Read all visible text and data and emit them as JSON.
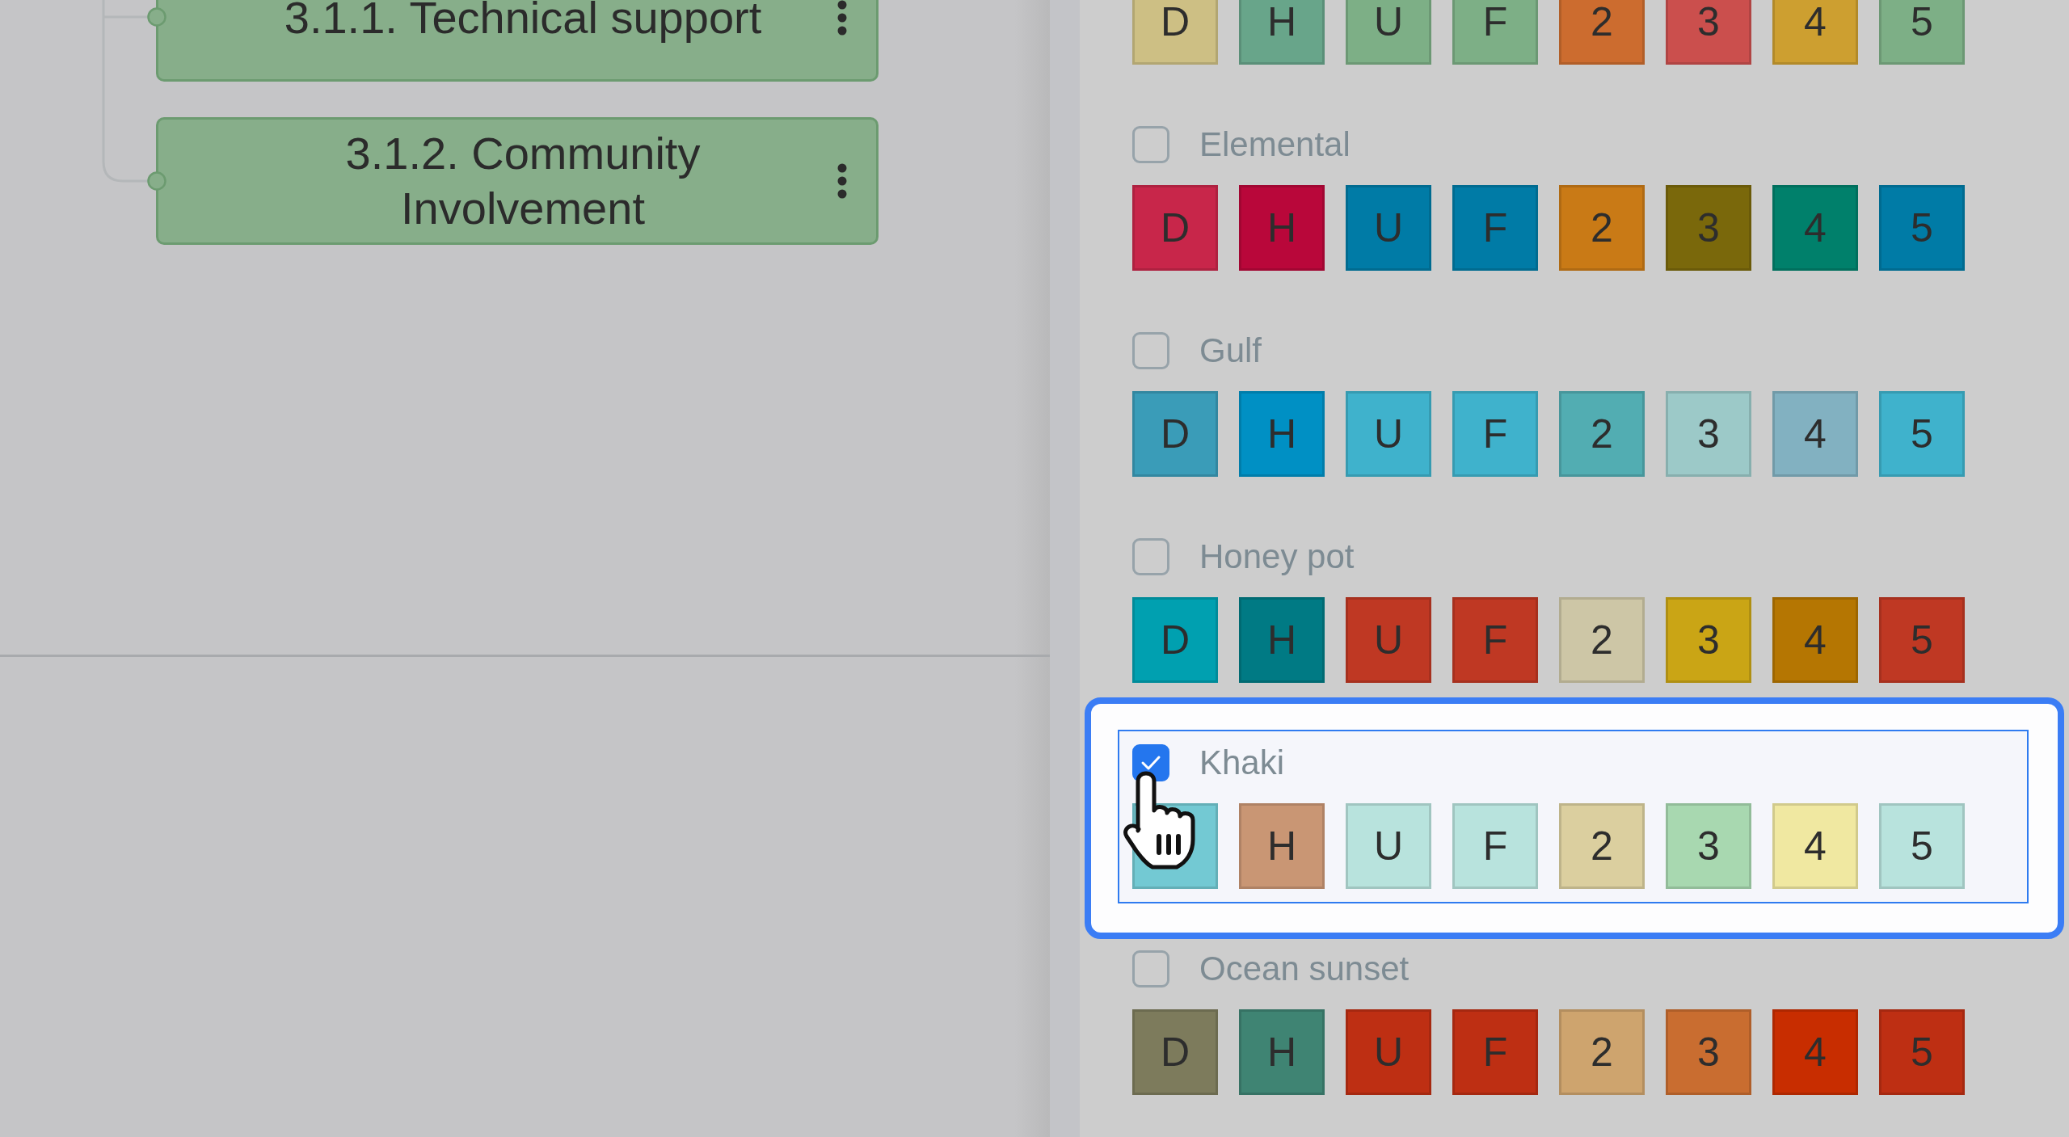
{
  "mind_map": {
    "nodes": [
      {
        "label": "3.1.1. Technical support"
      },
      {
        "label": "3.1.2. Community Involvement"
      }
    ]
  },
  "top_palette_swatches": [
    {
      "label": "D",
      "color": "#cdbf84"
    },
    {
      "label": "H",
      "color": "#68a58a"
    },
    {
      "label": "U",
      "color": "#7daf86"
    },
    {
      "label": "F",
      "color": "#7daf86"
    },
    {
      "label": "2",
      "color": "#cc6c2f"
    },
    {
      "label": "3",
      "color": "#cb4f4d"
    },
    {
      "label": "4",
      "color": "#cd9f30"
    },
    {
      "label": "5",
      "color": "#7daf86"
    }
  ],
  "palettes": [
    {
      "name": "Elemental",
      "checked": false,
      "selected": false,
      "swatches": [
        {
          "label": "D",
          "color": "#c8264a"
        },
        {
          "label": "H",
          "color": "#b9073a"
        },
        {
          "label": "U",
          "color": "#007ba6"
        },
        {
          "label": "F",
          "color": "#007ba6"
        },
        {
          "label": "2",
          "color": "#c97a16"
        },
        {
          "label": "3",
          "color": "#7a680b"
        },
        {
          "label": "4",
          "color": "#00806b"
        },
        {
          "label": "5",
          "color": "#007ba6"
        }
      ]
    },
    {
      "name": "Gulf",
      "checked": false,
      "selected": false,
      "swatches": [
        {
          "label": "D",
          "color": "#3a9cb8"
        },
        {
          "label": "H",
          "color": "#0090c4"
        },
        {
          "label": "U",
          "color": "#3fb2cc"
        },
        {
          "label": "F",
          "color": "#3fb2cc"
        },
        {
          "label": "2",
          "color": "#52adb2"
        },
        {
          "label": "3",
          "color": "#9cc9c8"
        },
        {
          "label": "4",
          "color": "#82b1c1"
        },
        {
          "label": "5",
          "color": "#3fb2cc"
        }
      ]
    },
    {
      "name": "Honey pot",
      "checked": false,
      "selected": false,
      "swatches": [
        {
          "label": "D",
          "color": "#00a0b0"
        },
        {
          "label": "H",
          "color": "#007a84"
        },
        {
          "label": "U",
          "color": "#bf3823"
        },
        {
          "label": "F",
          "color": "#bf3823"
        },
        {
          "label": "2",
          "color": "#cdc6a6"
        },
        {
          "label": "3",
          "color": "#caa515"
        },
        {
          "label": "4",
          "color": "#b57602"
        },
        {
          "label": "5",
          "color": "#bf3823"
        }
      ]
    },
    {
      "name": "Khaki",
      "checked": true,
      "selected": true,
      "swatches": [
        {
          "color": "#73c9d3"
        },
        {
          "label": "H",
          "color": "#c99674"
        },
        {
          "label": "U",
          "color": "#b8e3dd"
        },
        {
          "label": "F",
          "color": "#b8e3dd"
        },
        {
          "label": "2",
          "color": "#dbcf9f"
        },
        {
          "label": "3",
          "color": "#a8d8b0"
        },
        {
          "label": "4",
          "color": "#f0e8a1"
        },
        {
          "label": "5",
          "color": "#b8e3dd"
        }
      ]
    },
    {
      "name": "Ocean sunset",
      "checked": false,
      "selected": false,
      "swatches": [
        {
          "label": "D",
          "color": "#7d7b5c"
        },
        {
          "label": "H",
          "color": "#3f8473"
        },
        {
          "label": "U",
          "color": "#be2f13"
        },
        {
          "label": "F",
          "color": "#be2f13"
        },
        {
          "label": "2",
          "color": "#cea46e"
        },
        {
          "label": "3",
          "color": "#c96d30"
        },
        {
          "label": "4",
          "color": "#c82d00"
        },
        {
          "label": "5",
          "color": "#be2f13"
        }
      ]
    }
  ]
}
